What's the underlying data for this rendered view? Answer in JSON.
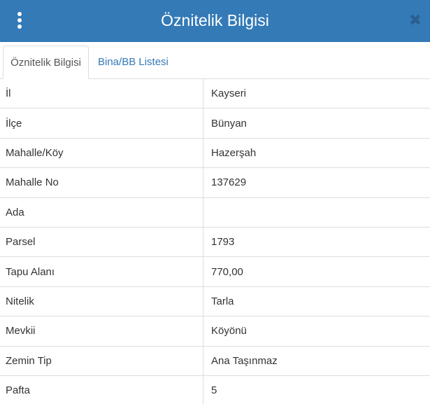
{
  "header": {
    "title": "Öznitelik Bilgisi",
    "close_symbol": "✖",
    "menu_icon": "vertical-ellipsis-icon",
    "background_color": "#337ab7"
  },
  "tabs": [
    {
      "label": "Öznitelik Bilgisi",
      "active": true
    },
    {
      "label": "Bina/BB Listesi",
      "active": false
    }
  ],
  "attributes": [
    {
      "label": "İl",
      "value": "Kayseri"
    },
    {
      "label": "İlçe",
      "value": "Bünyan"
    },
    {
      "label": "Mahalle/Köy",
      "value": "Hazerşah"
    },
    {
      "label": "Mahalle No",
      "value": "137629"
    },
    {
      "label": "Ada",
      "value": ""
    },
    {
      "label": "Parsel",
      "value": "1793"
    },
    {
      "label": "Tapu Alanı",
      "value": "770,00"
    },
    {
      "label": "Nitelik",
      "value": "Tarla"
    },
    {
      "label": "Mevkii",
      "value": "Köyönü"
    },
    {
      "label": "Zemin Tip",
      "value": "Ana Taşınmaz"
    },
    {
      "label": "Pafta",
      "value": "5"
    }
  ]
}
